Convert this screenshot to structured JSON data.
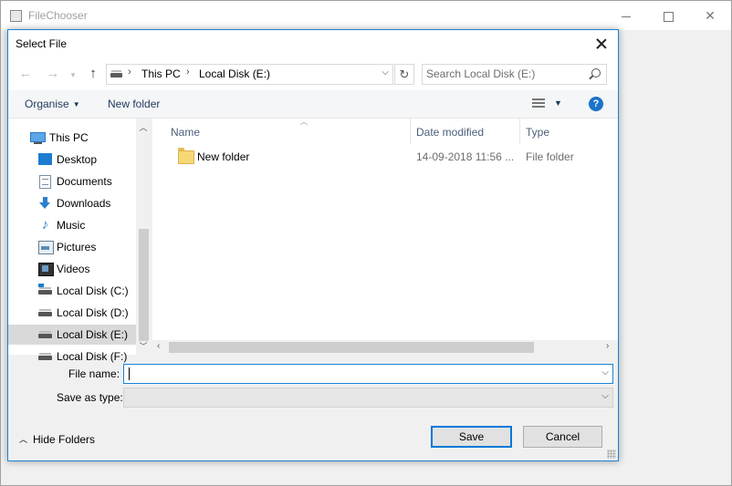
{
  "outer_window": {
    "title": "FileChooser"
  },
  "dialog": {
    "title": "Select File",
    "address": {
      "segments": [
        "This PC",
        "Local Disk (E:)"
      ]
    },
    "search": {
      "placeholder": "Search Local Disk (E:)"
    },
    "toolbar": {
      "organise_label": "Organise",
      "new_folder_label": "New folder",
      "help_icon": "?"
    },
    "nav_tree": [
      {
        "label": "This PC",
        "icon": "computer-icon"
      },
      {
        "label": "Desktop",
        "icon": "desktop-icon"
      },
      {
        "label": "Documents",
        "icon": "documents-icon"
      },
      {
        "label": "Downloads",
        "icon": "downloads-icon"
      },
      {
        "label": "Music",
        "icon": "music-icon"
      },
      {
        "label": "Pictures",
        "icon": "pictures-icon"
      },
      {
        "label": "Videos",
        "icon": "videos-icon"
      },
      {
        "label": "Local Disk (C:)",
        "icon": "system-drive-icon"
      },
      {
        "label": "Local Disk (D:)",
        "icon": "drive-icon"
      },
      {
        "label": "Local Disk (E:)",
        "icon": "drive-icon",
        "selected": true
      },
      {
        "label": "Local Disk (F:)",
        "icon": "drive-icon"
      }
    ],
    "file_list": {
      "columns": [
        "Name",
        "Date modified",
        "Type"
      ],
      "rows": [
        {
          "name": "New folder",
          "date": "14-09-2018 11:56 ...",
          "type": "File folder",
          "icon": "folder-icon"
        }
      ]
    },
    "file_name": {
      "label": "File name:",
      "value": ""
    },
    "save_as_type": {
      "label": "Save as type:",
      "value": ""
    },
    "hide_folders_label": "Hide Folders",
    "save_label": "Save",
    "cancel_label": "Cancel"
  },
  "colors": {
    "accent": "#0078d7",
    "dialog_border": "#1883d7",
    "selection": "#d9d9d9"
  }
}
